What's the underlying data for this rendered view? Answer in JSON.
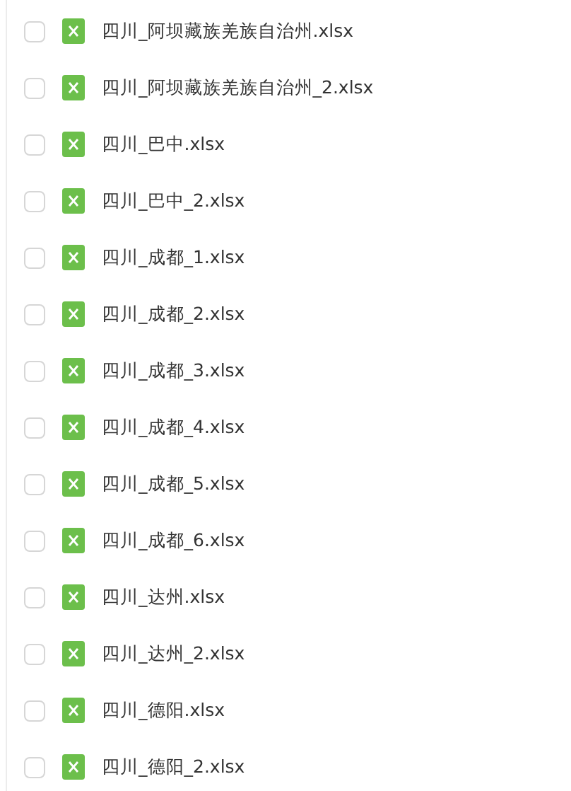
{
  "files": [
    {
      "name": "四川_阿坝藏族羌族自治州.xlsx",
      "checked": false
    },
    {
      "name": "四川_阿坝藏族羌族自治州_2.xlsx",
      "checked": false
    },
    {
      "name": "四川_巴中.xlsx",
      "checked": false
    },
    {
      "name": "四川_巴中_2.xlsx",
      "checked": false
    },
    {
      "name": "四川_成都_1.xlsx",
      "checked": false
    },
    {
      "name": "四川_成都_2.xlsx",
      "checked": false
    },
    {
      "name": "四川_成都_3.xlsx",
      "checked": false
    },
    {
      "name": "四川_成都_4.xlsx",
      "checked": false
    },
    {
      "name": "四川_成都_5.xlsx",
      "checked": false
    },
    {
      "name": "四川_成都_6.xlsx",
      "checked": false
    },
    {
      "name": "四川_达州.xlsx",
      "checked": false
    },
    {
      "name": "四川_达州_2.xlsx",
      "checked": false
    },
    {
      "name": "四川_德阳.xlsx",
      "checked": false
    },
    {
      "name": "四川_德阳_2.xlsx",
      "checked": false
    }
  ]
}
